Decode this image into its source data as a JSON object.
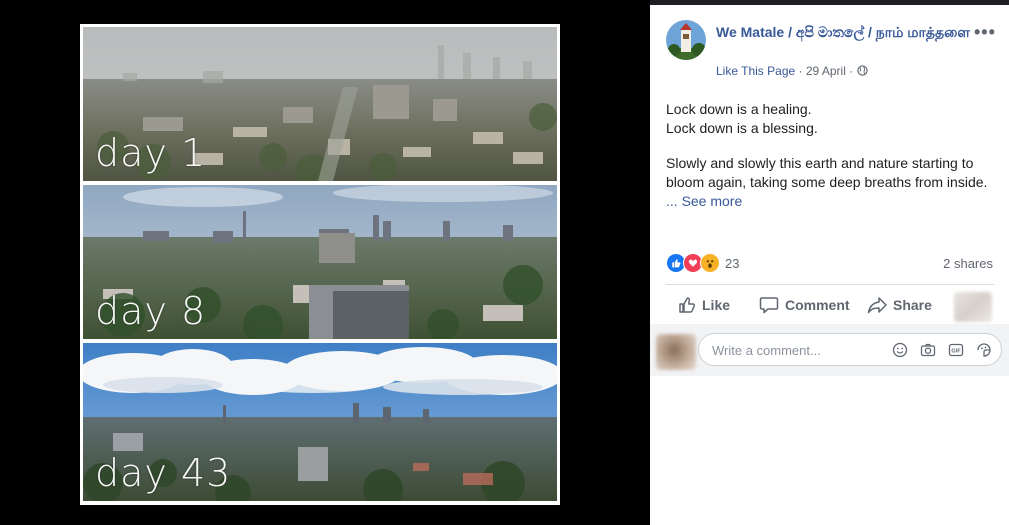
{
  "post": {
    "page_name": "We Matale / අපි මාතලේ / நாம் மாத்தளை",
    "like_page": "Like This Page",
    "sep": " · ",
    "date": "29 April",
    "text_lines": [
      "Lock down is a healing.",
      "Lock down is a blessing."
    ],
    "paragraph2": "Slowly and slowly this earth and nature starting to bloom again, taking some deep breaths from inside.",
    "ellipsis": "... ",
    "see_more": "See more"
  },
  "photo": {
    "panels": [
      {
        "label": "day 1"
      },
      {
        "label": "day 8"
      },
      {
        "label": "day 43"
      }
    ]
  },
  "reactions": {
    "count": "23",
    "shares": "2 shares",
    "colors": {
      "like": "#1877f2",
      "love": "#f33e58",
      "wow": "#f7b125"
    }
  },
  "actions": {
    "like": "Like",
    "comment": "Comment",
    "share": "Share"
  },
  "comment": {
    "placeholder": "Write a comment..."
  },
  "icons": [
    "globe-icon",
    "more-options-icon",
    "like-icon",
    "comment-icon",
    "share-icon",
    "emoji-icon",
    "camera-icon",
    "gif-icon",
    "sticker-icon"
  ]
}
